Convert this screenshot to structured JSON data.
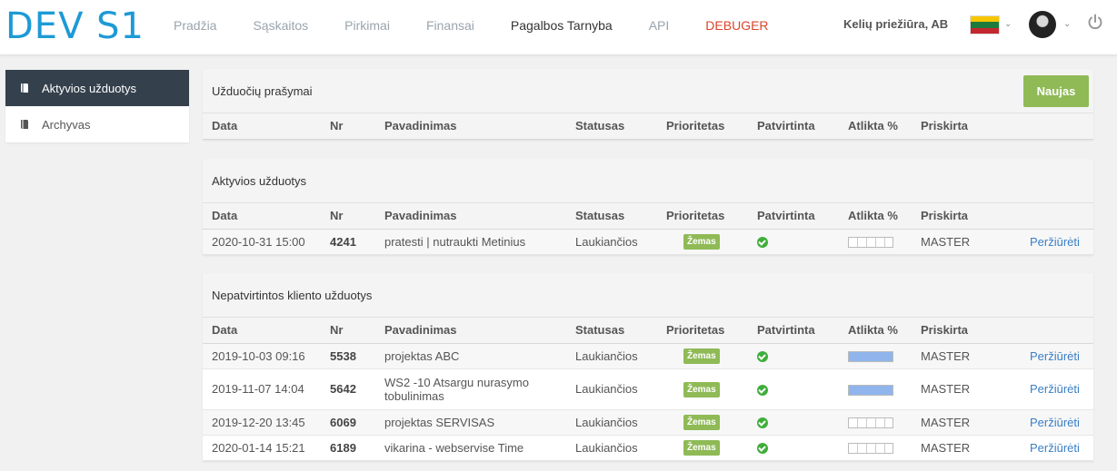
{
  "app": {
    "logo": "DEV S1"
  },
  "nav": [
    {
      "label": "Pradžia"
    },
    {
      "label": "Sąskaitos"
    },
    {
      "label": "Pirkimai"
    },
    {
      "label": "Finansai"
    },
    {
      "label": "Pagalbos Tarnyba",
      "active": true
    },
    {
      "label": "API"
    },
    {
      "label": "DEBUGER"
    }
  ],
  "header": {
    "company": "Kelių priežiūra, AB",
    "flag_colors": [
      "#f7c600",
      "#1d7a3d",
      "#c4272e"
    ]
  },
  "sidebar": {
    "items": [
      {
        "label": "Aktyvios užduotys",
        "active": true
      },
      {
        "label": "Archyvas"
      }
    ]
  },
  "columns": [
    "Data",
    "Nr",
    "Pavadinimas",
    "Statusas",
    "Prioritetas",
    "Patvirtinta",
    "Atlikta %",
    "Priskirta"
  ],
  "requests": {
    "title": "Užduočių prašymai",
    "new_button": "Naujas"
  },
  "active": {
    "title": "Aktyvios užduotys",
    "rows": [
      {
        "date": "2020-10-31 15:00",
        "nr": "4241",
        "name": "pratesti | nutraukti Metinius",
        "status": "Laukiančios",
        "priority": "Žemas",
        "progress": 0,
        "assigned": "MASTER",
        "action": "Peržiūrėti"
      }
    ]
  },
  "unconfirmed": {
    "title": "Nepatvirtintos kliento užduotys",
    "rows": [
      {
        "date": "2019-10-03 09:16",
        "nr": "5538",
        "name": "projektas ABC",
        "status": "Laukiančios",
        "priority": "Žemas",
        "progress": 1.0,
        "assigned": "MASTER",
        "action": "Peržiūrėti"
      },
      {
        "date": "2019-11-07 14:04",
        "nr": "5642",
        "name": "WS2 -10 Atsargu nurasymo tobulinimas",
        "status": "Laukiančios",
        "priority": "Žemas",
        "progress": 1.0,
        "assigned": "MASTER",
        "action": "Peržiūrėti"
      },
      {
        "date": "2019-12-20 13:45",
        "nr": "6069",
        "name": "projektas SERVISAS",
        "status": "Laukiančios",
        "priority": "Žemas",
        "progress": 0,
        "assigned": "MASTER",
        "action": "Peržiūrėti"
      },
      {
        "date": "2020-01-14 15:21",
        "nr": "6189",
        "name": "vikarina - webservise Time",
        "status": "Laukiančios",
        "priority": "Žemas",
        "progress": 0,
        "assigned": "MASTER",
        "action": "Peržiūrėti"
      }
    ]
  }
}
